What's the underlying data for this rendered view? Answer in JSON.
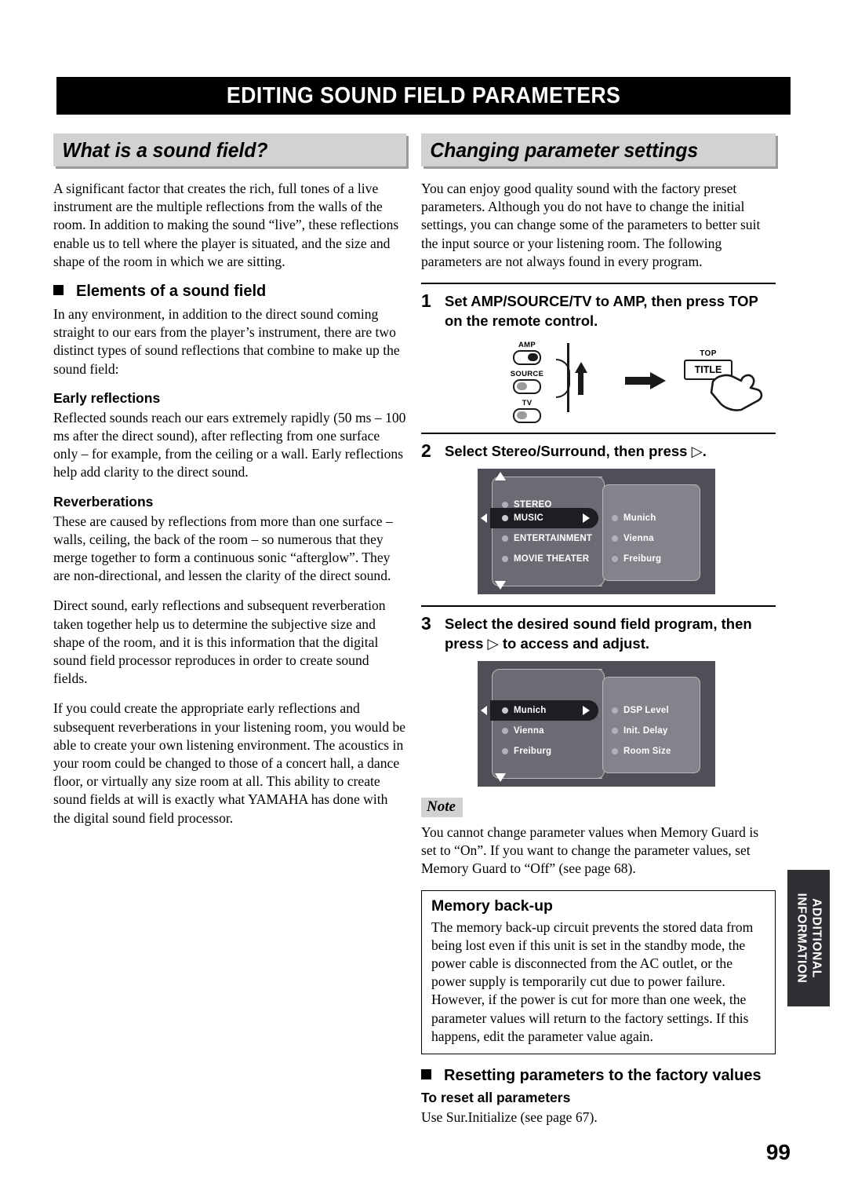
{
  "page": {
    "title": "EDITING SOUND FIELD PARAMETERS",
    "number": "99",
    "side_tab_line1": "ADDITIONAL",
    "side_tab_line2": "INFORMATION"
  },
  "left_column": {
    "banner": "What is a sound field?",
    "intro": "A significant factor that creates the rich, full tones of a live instrument are the multiple reflections from the walls of the room. In addition to making the sound “live”, these reflections enable us to tell where the player is situated, and the size and shape of the room in which we are sitting.",
    "elements_heading": "Elements of a sound field",
    "elements_body": "In any environment, in addition to the direct sound coming straight to our ears from the player’s instrument, there are two distinct types of sound reflections that combine to make up the sound field:",
    "early_heading": "Early reflections",
    "early_body": "Reflected sounds reach our ears extremely rapidly (50 ms – 100 ms after the direct sound), after reflecting from one surface only – for example, from the ceiling or a wall. Early reflections help add clarity to the direct sound.",
    "reverb_heading": "Reverberations",
    "reverb_body": "These are caused by reflections from more than one surface – walls, ceiling, the back of the room – so numerous that they merge together to form a continuous sonic “afterglow”. They are non-directional, and lessen the clarity of the direct sound.",
    "para3": "Direct sound, early reflections and subsequent reverberation taken together help us to determine the subjective size and shape of the room, and it is this information that the digital sound field processor reproduces in order to create sound fields.",
    "para4": "If you could create the appropriate early reflections and subsequent reverberations in your listening room, you would be able to create your own listening environment. The acoustics in your room could be changed to those of a concert hall, a dance floor, or virtually any size room at all. This ability to create sound fields at will is exactly what YAMAHA has done with the digital sound field processor."
  },
  "right_column": {
    "banner": "Changing parameter settings",
    "intro": "You can enjoy good quality sound with the factory preset parameters. Although you do not have to change the initial settings, you can change some of the parameters to better suit the input source or your listening room. The following parameters are not always found in every program.",
    "steps": [
      {
        "number": "1",
        "text": "Set AMP/SOURCE/TV to AMP, then press TOP on the remote control."
      },
      {
        "number": "2",
        "text": "Select Stereo/Surround, then press ▷."
      },
      {
        "number": "3",
        "text": "Select the desired sound field program, then press ▷ to access and adjust."
      }
    ],
    "remote_figure": {
      "selector_labels": [
        "AMP",
        "SOURCE",
        "TV"
      ],
      "selected": "AMP",
      "top_label": "TOP",
      "key_label": "TITLE"
    },
    "osd_step2": {
      "left_items": [
        "STEREO",
        "MUSIC",
        "ENTERTAINMENT",
        "MOVIE THEATER"
      ],
      "left_selected": "MUSIC",
      "right_items": [
        "Munich",
        "Vienna",
        "Freiburg"
      ],
      "has_up_arrow": true,
      "has_down_arrow": true
    },
    "osd_step3": {
      "left_items": [
        "Munich",
        "Vienna",
        "Freiburg"
      ],
      "left_selected": "Munich",
      "right_items": [
        "DSP Level",
        "Init. Delay",
        "Room Size"
      ],
      "has_up_arrow": false,
      "has_down_arrow": true
    },
    "note": {
      "tag": "Note",
      "body": "You cannot change parameter values when Memory Guard is set to “On”. If you want to change the parameter values, set Memory Guard to “Off” (see page 68)."
    },
    "memory_backup": {
      "heading": "Memory back-up",
      "body": "The memory back-up circuit prevents the stored data from being lost even if this unit is set in the standby mode, the power cable is disconnected from the AC outlet, or the power supply is temporarily cut due to power failure. However, if the power is cut for more than one week, the parameter values will return to the factory settings. If this happens, edit the parameter value again."
    },
    "resetting": {
      "heading": "Resetting parameters to the factory values",
      "sub_heading": "To reset all parameters",
      "body": "Use Sur.Initialize (see page 67)."
    }
  }
}
